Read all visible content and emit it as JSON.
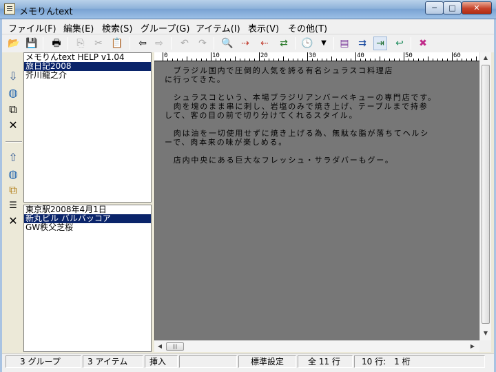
{
  "window": {
    "title": "メモりんtext",
    "minimize": "─",
    "maximize": "□",
    "close": "✕"
  },
  "menu": [
    {
      "label": "ファイル(F)"
    },
    {
      "label": "編集(E)"
    },
    {
      "label": "検索(S)"
    },
    {
      "label": "グループ(G)"
    },
    {
      "label": "アイテム(I)"
    },
    {
      "label": "表示(V)"
    },
    {
      "label": "その他(T)"
    }
  ],
  "toolbar": [
    {
      "icon": "open-folder-icon",
      "glyph": "📂"
    },
    {
      "icon": "save-icon",
      "glyph": "💾"
    },
    {
      "icon": "print-icon",
      "glyph": "🖶"
    },
    {
      "icon": "copy-icon",
      "glyph": "⎘"
    },
    {
      "icon": "cut-icon",
      "glyph": "✂"
    },
    {
      "icon": "paste-icon",
      "glyph": "📋"
    },
    {
      "icon": "back-arrow-icon",
      "glyph": "⇦"
    },
    {
      "icon": "forward-arrow-icon",
      "glyph": "⇨"
    },
    {
      "icon": "undo-icon",
      "glyph": "↶"
    },
    {
      "icon": "redo-icon",
      "glyph": "↷"
    },
    {
      "icon": "find-icon",
      "glyph": "🔍"
    },
    {
      "icon": "find-next-icon",
      "glyph": "⇢"
    },
    {
      "icon": "find-prev-icon",
      "glyph": "⇠"
    },
    {
      "icon": "replace-icon",
      "glyph": "⇄"
    },
    {
      "icon": "clock-icon",
      "glyph": "🕒"
    },
    {
      "icon": "dropdown-arrow-icon",
      "glyph": "▼"
    },
    {
      "icon": "edit-mode-icon",
      "glyph": "▤"
    },
    {
      "icon": "indent-icon",
      "glyph": "⇉"
    },
    {
      "icon": "column-icon",
      "glyph": "⇥"
    },
    {
      "icon": "wrap-icon",
      "glyph": "↩"
    },
    {
      "icon": "close-search-icon",
      "glyph": "✖"
    }
  ],
  "side_icons_top": [
    {
      "icon": "move-down-icon",
      "glyph": "⇩"
    },
    {
      "icon": "globe-icon",
      "glyph": "◍"
    },
    {
      "icon": "duplicate-icon",
      "glyph": "⧉"
    },
    {
      "icon": "delete-group-icon",
      "glyph": "✕"
    }
  ],
  "side_icons_bottom": [
    {
      "icon": "move-up-icon",
      "glyph": "⇧"
    },
    {
      "icon": "globe-icon",
      "glyph": "◍"
    },
    {
      "icon": "copy-item-icon",
      "glyph": "⧉"
    },
    {
      "icon": "new-item-icon",
      "glyph": "☰"
    },
    {
      "icon": "delete-item-icon",
      "glyph": "✕"
    }
  ],
  "groups": {
    "items": [
      "メモりんtext HELP v1.04",
      "旅日記2008",
      "芥川龍之介"
    ],
    "selected": 1
  },
  "items": {
    "items": [
      "東京駅2008年4月1日",
      "新丸ビル バルバッコア",
      "GW秩父芝桜"
    ],
    "selected": 1
  },
  "ruler": {
    "labels": [
      "0",
      "10",
      "20",
      "30",
      "40",
      "50",
      "60"
    ]
  },
  "editor": {
    "lines": [
      "　ブラジル国内で圧倒的人気を誇る有名シュラスコ料理店",
      "に行ってきた。",
      "",
      "　シュラスコという、本場ブラジリアンバーベキューの専門店です。",
      "　肉を塊のまま串に刺し、岩塩のみで焼き上げ、テーブルまで持参",
      "して、客の目の前で切り分けてくれるスタイル。",
      "",
      "　肉は油を一切使用せずに焼き上げる為、無駄な脂が落ちてヘルシ",
      "ーで、肉本来の味が楽しめる。",
      "",
      "　店内中央にある巨大なフレッシュ・サラダバーもグー。"
    ]
  },
  "status": {
    "groups": "3 グループ",
    "items": "3 アイテム",
    "insert": "挿入",
    "blank": "",
    "encoding": "標準設定",
    "lines": "全 11 行",
    "position": "10 行:　1 桁"
  },
  "colors": {
    "selection": "#0a246a",
    "editor_bg": "#777777"
  }
}
